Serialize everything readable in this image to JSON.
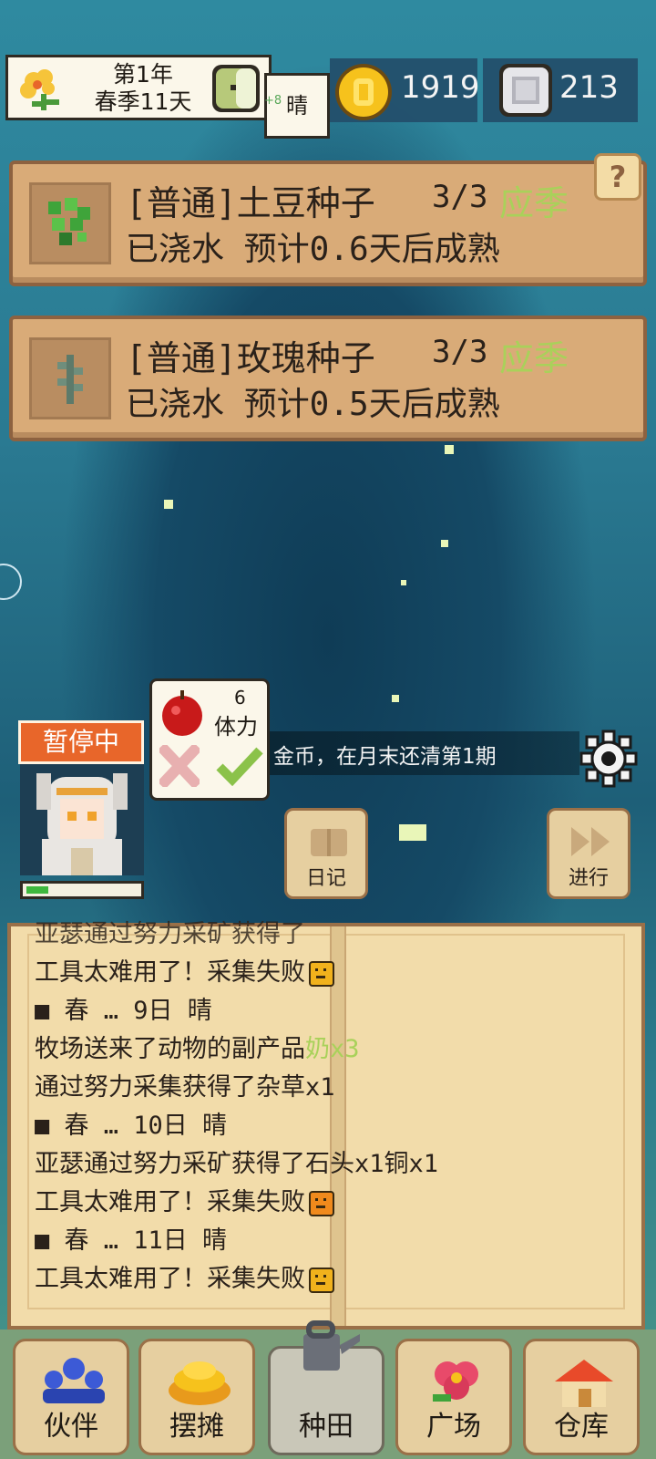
{
  "header": {
    "year": "第1年",
    "season_day": "春季11天",
    "weather": "晴",
    "weather_sub": "+8"
  },
  "resources": {
    "gold": "1919",
    "gems": "213"
  },
  "crops": [
    {
      "title": "[普通]土豆种子",
      "count": "3/3",
      "season": "应季",
      "status": "已浇水 预计0.6天后成熟"
    },
    {
      "title": "[普通]玫瑰种子",
      "count": "3/3",
      "season": "应季",
      "status": "已浇水 预计0.5天后成熟"
    }
  ],
  "help_label": "?",
  "character": {
    "status": "暂停中",
    "stamina_value": "6",
    "stamina_label": "体力",
    "hp_fraction": 0.2
  },
  "message": "金币，在月末还清第1期",
  "buttons": {
    "diary": "日记",
    "proceed": "进行"
  },
  "journal": [
    {
      "text": "亚瑟通过努力采矿获得了",
      "hl": "",
      "face": ""
    },
    {
      "text": "工具太难用了！采集失败",
      "hl": "",
      "face": "neutral"
    },
    {
      "text": "■ 春 … 9日 晴",
      "hl": "",
      "face": ""
    },
    {
      "text": "牧场送来了动物的副产品",
      "hl": "奶x3",
      "face": ""
    },
    {
      "text": "通过努力采集获得了杂草x1",
      "hl": "",
      "face": ""
    },
    {
      "text": "■ 春 … 10日 晴",
      "hl": "",
      "face": ""
    },
    {
      "text": "亚瑟通过努力采矿获得了石头x1铜x1",
      "hl": "",
      "face": ""
    },
    {
      "text": "工具太难用了！采集失败",
      "hl": "",
      "face": "sad"
    },
    {
      "text": "■ 春 … 11日 晴",
      "hl": "",
      "face": ""
    },
    {
      "text": "工具太难用了！采集失败",
      "hl": "",
      "face": "neutral"
    }
  ],
  "nav": {
    "partner": "伙伴",
    "stall": "摆摊",
    "farm": "种田",
    "plaza": "广场",
    "storage": "仓库"
  },
  "colors": {
    "accent_orange": "#e8662a",
    "season_green": "#a9d15a",
    "panel_tan": "#d9ab78"
  }
}
